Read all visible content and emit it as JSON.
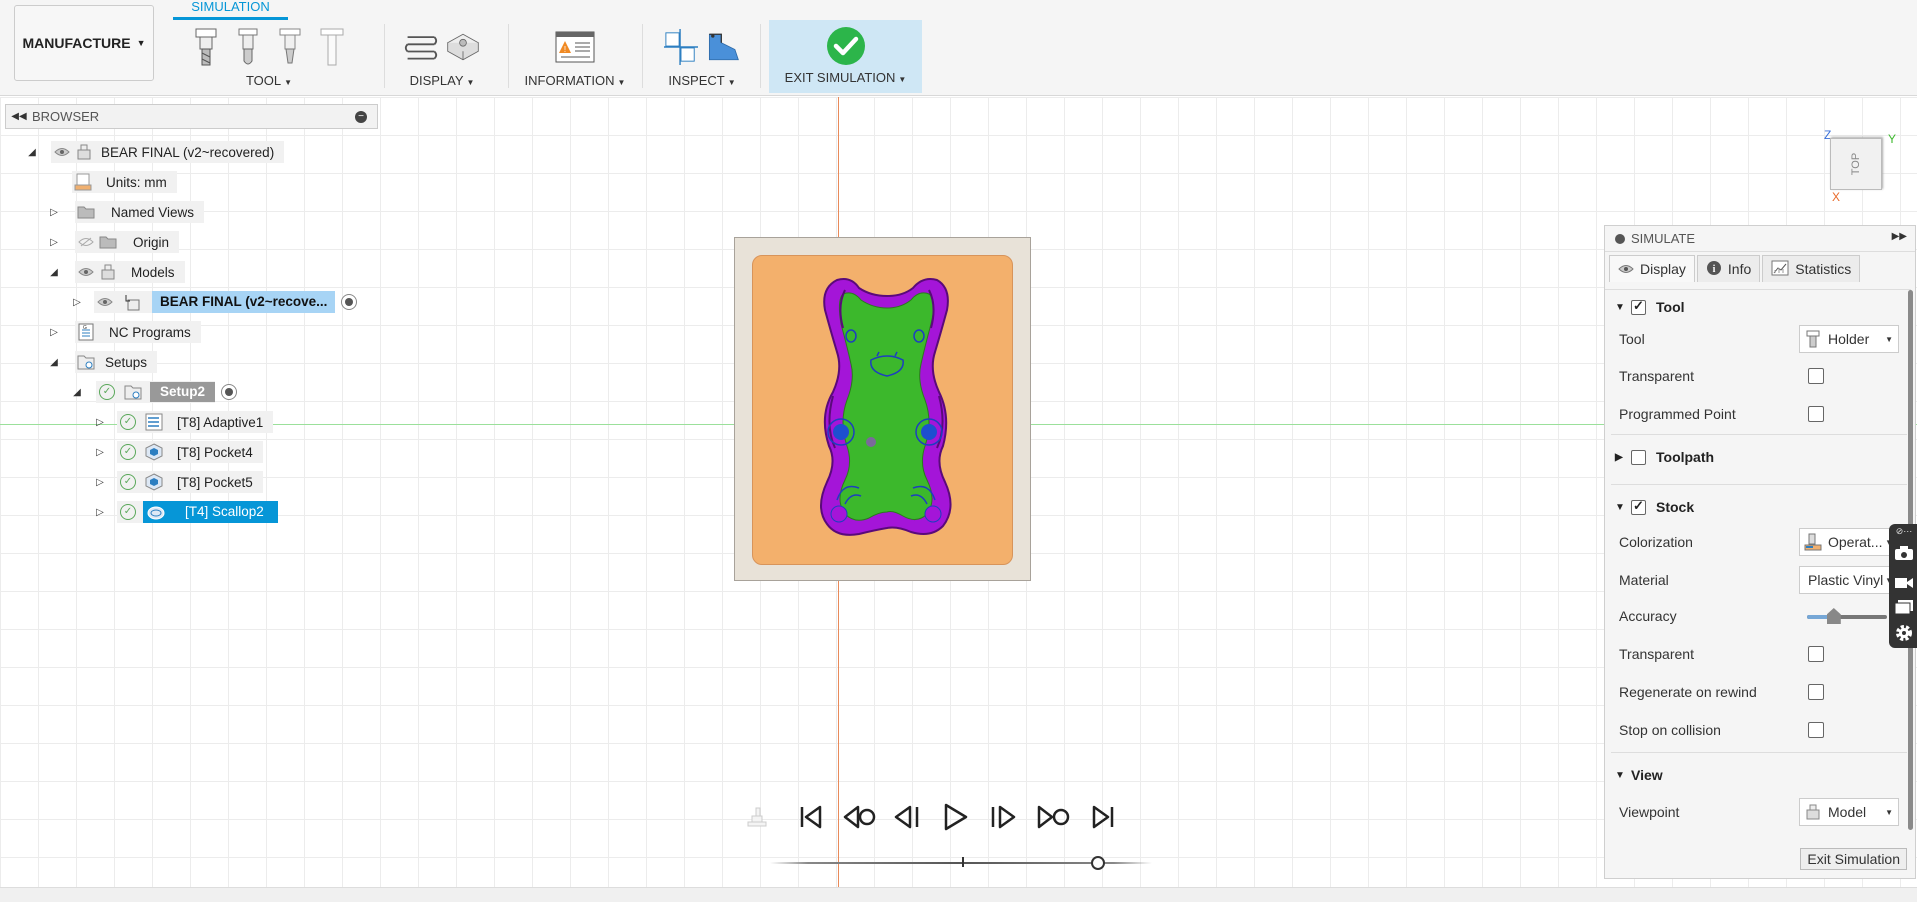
{
  "toolbar": {
    "workspace_label": "MANUFACTURE",
    "active_tab": "SIMULATION",
    "groups": {
      "tool": "TOOL",
      "display": "DISPLAY",
      "information": "INFORMATION",
      "inspect": "INSPECT",
      "exit": "EXIT SIMULATION"
    }
  },
  "browser": {
    "title": "BROWSER",
    "items": [
      {
        "label": "BEAR FINAL (v2~recovered)",
        "icon": "component-icon"
      },
      {
        "label": "Units: mm",
        "icon": "document-icon"
      },
      {
        "label": "Named Views",
        "icon": "folder-icon"
      },
      {
        "label": "Origin",
        "icon": "folder-icon"
      },
      {
        "label": "Models",
        "icon": "component-icon"
      },
      {
        "label": "BEAR FINAL (v2~recove...",
        "icon": "model-icon"
      },
      {
        "label": "NC Programs",
        "icon": "nc-program-icon"
      },
      {
        "label": "Setups",
        "icon": "setups-icon"
      },
      {
        "label": "Setup2",
        "icon": "setup-icon"
      },
      {
        "label": "[T8] Adaptive1",
        "icon": "adaptive-icon"
      },
      {
        "label": "[T8] Pocket4",
        "icon": "pocket-icon"
      },
      {
        "label": "[T8] Pocket5",
        "icon": "pocket-icon"
      },
      {
        "label": "[T4] Scallop2",
        "icon": "scallop-icon"
      }
    ]
  },
  "viewcube": {
    "face": "TOP",
    "axes": {
      "z": "Z",
      "y": "Y",
      "x": "X"
    }
  },
  "simulate": {
    "title": "SIMULATE",
    "tabs": [
      "Display",
      "Info",
      "Statistics"
    ],
    "sections": {
      "tool": {
        "title": "Tool",
        "checked": true
      },
      "toolpath": {
        "title": "Toolpath",
        "checked": false
      },
      "stock": {
        "title": "Stock",
        "checked": true
      },
      "view": {
        "title": "View"
      }
    },
    "rows": {
      "tool": {
        "label": "Tool",
        "value": "Holder"
      },
      "tool_transparent": {
        "label": "Transparent"
      },
      "programmed_point": {
        "label": "Programmed Point"
      },
      "colorization": {
        "label": "Colorization",
        "value": "Operat..."
      },
      "material": {
        "label": "Material",
        "value": "Plastic Vinyl"
      },
      "accuracy": {
        "label": "Accuracy",
        "level": 0.3
      },
      "stock_transparent": {
        "label": "Transparent"
      },
      "regenerate": {
        "label": "Regenerate on rewind"
      },
      "stop_collision": {
        "label": "Stop on collision"
      },
      "viewpoint": {
        "label": "Viewpoint",
        "value": "Model"
      }
    },
    "exit_button": "Exit Simulation"
  },
  "playback": {
    "progress": 0.83
  },
  "colors": {
    "accent": "#0696d7",
    "stock": "#f3b06c",
    "model_green": "#3cb82c",
    "model_purple": "#a415d8"
  }
}
